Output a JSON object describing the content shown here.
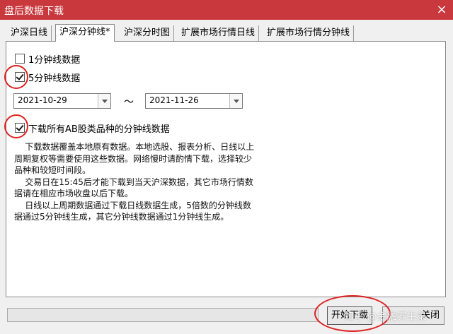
{
  "window": {
    "title": "盘后数据下载",
    "close_glyph": "×"
  },
  "tabs": [
    {
      "label": "沪深日线"
    },
    {
      "label": "沪深分钟线*"
    },
    {
      "label": "沪深分时图"
    },
    {
      "label": "扩展市场行情日线"
    },
    {
      "label": "扩展市场行情分钟线"
    }
  ],
  "options": {
    "one_min": {
      "label": "1分钟线数据",
      "checked": false
    },
    "five_min": {
      "label": "5分钟线数据",
      "checked": true
    },
    "all_ab": {
      "label": "下载所有AB股类品种的分钟线数据",
      "checked": true
    }
  },
  "date_range": {
    "start": "2021-10-29",
    "separator": "～",
    "end": "2021-11-26"
  },
  "description": [
    "    下载数据覆盖本地原有数据。本地选股、报表分析、日线以上周期复权等需要使用这些数据。网络慢时请酌情下载，选择较少品种和较短时间段。",
    "    交易日在15:45后才能下载到当天沪深数据，其它市场行情数据请在相应市场收盘以后下载。",
    "    日线以上周期数据通过下载日线数据生成，5倍数的分钟线数据通过5分钟线生成，其它分钟线数据通过1分钟线生成。"
  ],
  "footer": {
    "progress": 0,
    "start_label": "开始下载",
    "cancel_label": "关闭"
  },
  "watermark": "知乎 @金融养生录",
  "colors": {
    "titlebar": "#c8383d",
    "annotation": "#dd2222"
  }
}
